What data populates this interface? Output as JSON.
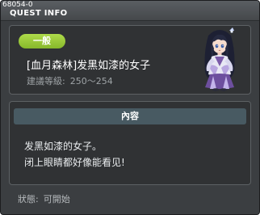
{
  "titlebar": {
    "quest_id": "68054-0",
    "title": "QUEST INFO"
  },
  "quest": {
    "category_badge": "一般",
    "name": "[血月森林]发黑如漆的女子",
    "level_label": "建議等級:",
    "level_range": "250～254",
    "npc_portrait": "npc-portrait-icon"
  },
  "content": {
    "header": "內容",
    "lines": [
      "发黑如漆的女子。",
      "闭上眼睛都好像能看见!"
    ]
  },
  "status": {
    "label": "狀態:",
    "value": "可開始"
  },
  "colors": {
    "window_bg": "#3b3e41",
    "panel_bg": "#303234",
    "badge_green": "#9ccb3c",
    "header_bg": "#485a62",
    "secondary_text": "#9ea3a6"
  }
}
